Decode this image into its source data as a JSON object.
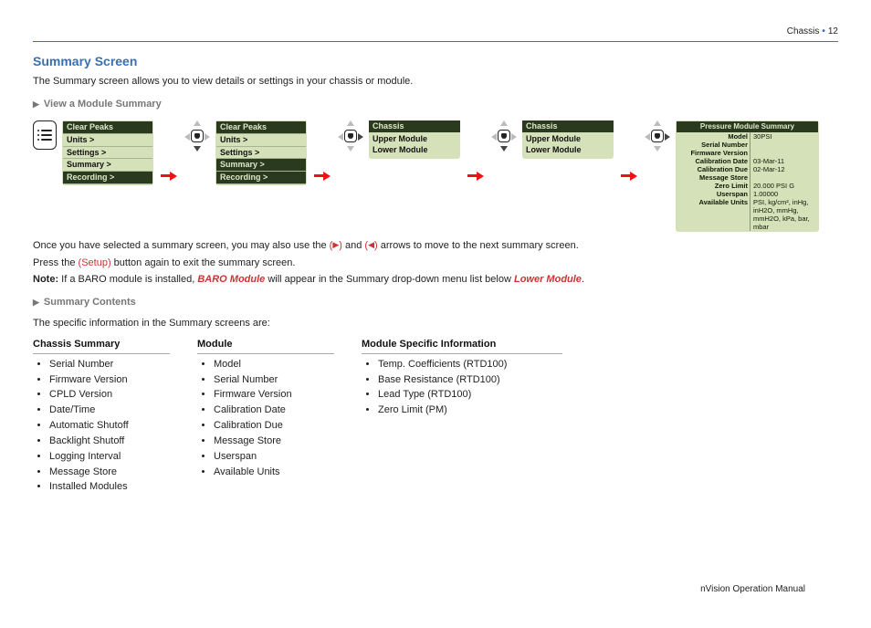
{
  "header": {
    "section": "Chassis",
    "page": "12"
  },
  "title": "Summary Screen",
  "intro": "The Summary screen allows you to view details or settings in your chassis or module.",
  "sub_view": "View a Module Summary",
  "menu_a": [
    "Clear Peaks",
    "Units >",
    "Settings >",
    "Summary >",
    "Recording >"
  ],
  "menu_b": [
    "Clear Peaks",
    "Units >",
    "Settings >",
    "Summary >",
    "Recording >"
  ],
  "list_c": {
    "hd": "Chassis",
    "rows": [
      "Upper Module",
      "Lower Module"
    ]
  },
  "list_d": {
    "hd": "Chassis",
    "rows": [
      "Upper Module",
      "Lower Module"
    ]
  },
  "summary_panel": {
    "title": "Pressure Module Summary",
    "rows": [
      [
        "Model",
        "30PSI"
      ],
      [
        "Serial Number",
        ""
      ],
      [
        "Firmware Version",
        ""
      ],
      [
        "Calibration Date",
        "03-Mar-11"
      ],
      [
        "Calibration Due",
        "02-Mar-12"
      ],
      [
        "Message Store",
        ""
      ],
      [
        "",
        ""
      ],
      [
        "Zero Limit",
        "20.000  PSI  G"
      ],
      [
        "Userspan",
        "1.00000"
      ],
      [
        "Available Units",
        "PSI, kg/cm², inHg, inH2O, mmHg, mmH2O, kPa, bar, mbar"
      ]
    ]
  },
  "after_flow_1a": "Once you have selected a summary screen, you may also use the ",
  "after_flow_1b": " and ",
  "after_flow_1c": " arrows to move to the next summary screen.",
  "after_flow_2a": "Press the ",
  "after_flow_2b_setup": "Setup",
  "after_flow_2c": " button again to exit the summary screen.",
  "note_label": "Note:",
  "note_a": "  If a BARO module is installed, ",
  "note_baro": "BARO Module",
  "note_b": " will appear in the Summary drop-down menu list below ",
  "note_lower": "Lower Module",
  "note_c": ".",
  "sub_contents": "Summary Contents",
  "contents_intro": "The specific information in the Summary screens are:",
  "col_chassis": {
    "title": "Chassis Summary",
    "items": [
      "Serial Number",
      "Firmware Version",
      "CPLD Version",
      "Date/Time",
      "Automatic Shutoff",
      "Backlight Shutoff",
      "Logging Interval",
      "Message Store",
      "Installed Modules"
    ]
  },
  "col_module": {
    "title": "Module",
    "items": [
      "Model",
      "Serial Number",
      "Firmware Version",
      "Calibration Date",
      "Calibration Due",
      "Message Store",
      "Userspan",
      "Available Units"
    ]
  },
  "col_specific": {
    "title": "Module Specific Information",
    "items": [
      "Temp. Coefficients (RTD100)",
      "Base Resistance (RTD100)",
      "Lead Type (RTD100)",
      "Zero Limit (PM)"
    ]
  },
  "footer": "nVision Operation Manual"
}
